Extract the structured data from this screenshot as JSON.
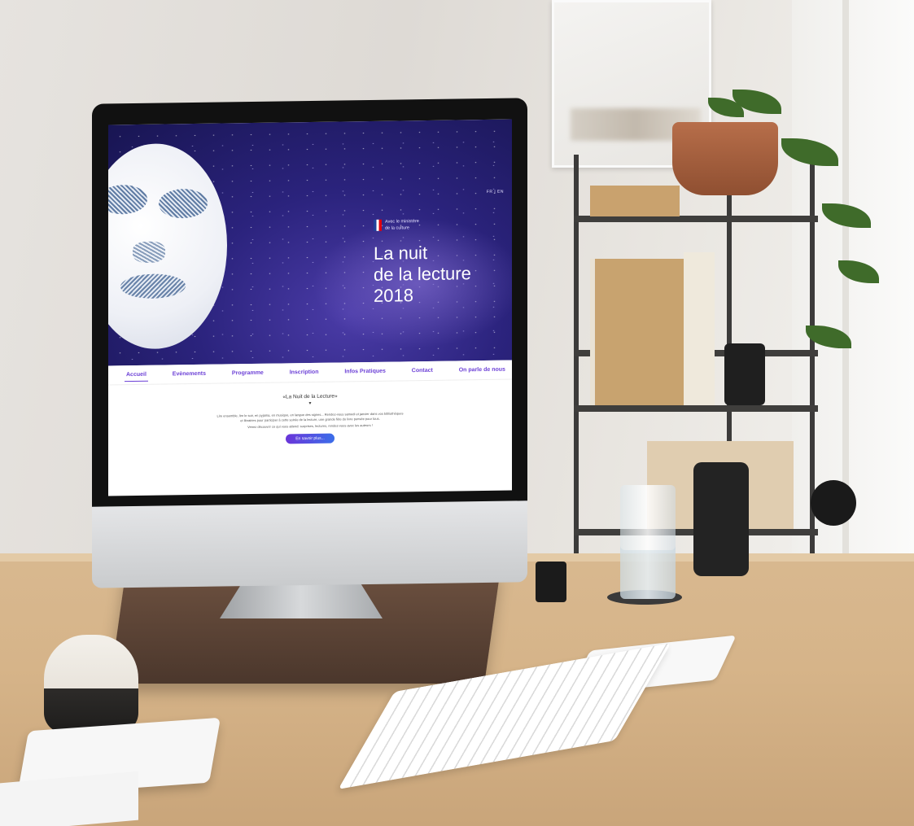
{
  "website": {
    "lang_switch": "FR | EN",
    "ministry": {
      "line1": "Avec le ministère",
      "line2": "de la culture"
    },
    "title_line1": "La nuit",
    "title_line2": "de la lecture 2018",
    "nav": [
      {
        "label": "Accueil",
        "active": true
      },
      {
        "label": "Evènements",
        "active": false
      },
      {
        "label": "Programme",
        "active": false
      },
      {
        "label": "Inscription",
        "active": false
      },
      {
        "label": "Infos Pratiques",
        "active": false
      },
      {
        "label": "Contact",
        "active": false
      },
      {
        "label": "On parle de nous",
        "active": false
      }
    ],
    "section_heading": "«La Nuit de la Lecture»",
    "paragraph_1": "Lire ensemble, lire le soir, en pyjama, en musique, en langue des signes... Rendez-vous samedi et janvier dans vos bibliothèques et librairies pour participer à cette soirée de la lecture, une grande fête du livre pensée pour tous.",
    "paragraph_2": "Venez découvrir ce qui vous attend: surprises, lectures, rendez-vous avec les auteurs !",
    "cta_label": "En savoir plus..."
  },
  "colors": {
    "accent": "#6b3fd6",
    "hero_dark": "#181552",
    "hero_mid": "#2b237d"
  },
  "icons": {
    "flag": "french-republic-flag-icon"
  }
}
